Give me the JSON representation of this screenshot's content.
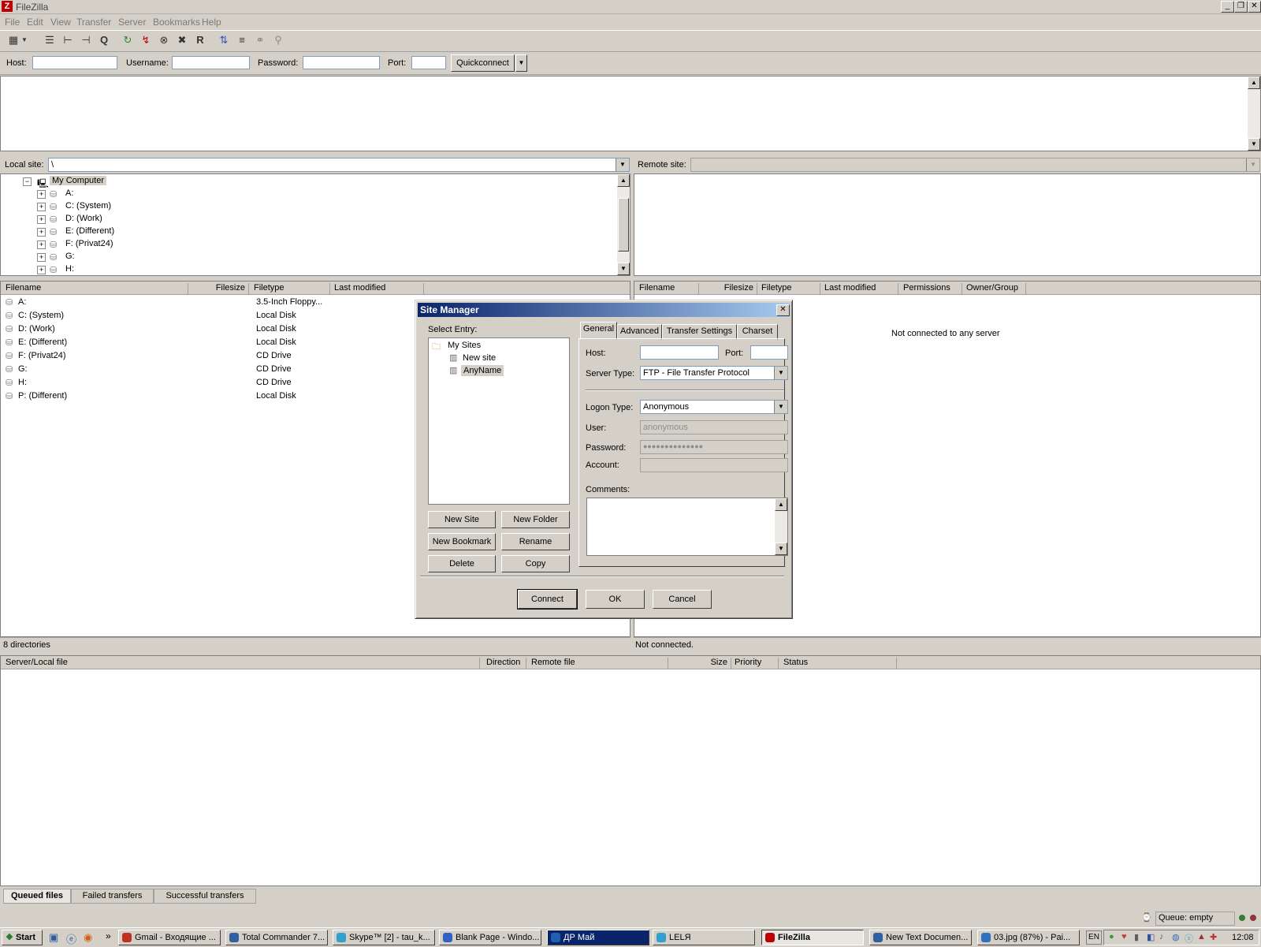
{
  "window": {
    "title": "FileZilla"
  },
  "menu": [
    "File",
    "Edit",
    "View",
    "Transfer",
    "Server",
    "Bookmarks",
    "Help"
  ],
  "quickconnect": {
    "host_label": "Host:",
    "username_label": "Username:",
    "password_label": "Password:",
    "port_label": "Port:",
    "button": "Quickconnect"
  },
  "local": {
    "label": "Local site:",
    "path": "\\",
    "tree": {
      "root": "My Computer",
      "items": [
        "A:",
        "C: (System)",
        "D: (Work)",
        "E: (Different)",
        "F: (Privat24)",
        "G:",
        "H:"
      ]
    },
    "columns": [
      "Filename",
      "Filesize",
      "Filetype",
      "Last modified"
    ],
    "files": [
      {
        "name": "A:",
        "type": "3.5-Inch Floppy..."
      },
      {
        "name": "C: (System)",
        "type": "Local Disk"
      },
      {
        "name": "D: (Work)",
        "type": "Local Disk"
      },
      {
        "name": "E: (Different)",
        "type": "Local Disk"
      },
      {
        "name": "F: (Privat24)",
        "type": "CD Drive"
      },
      {
        "name": "G:",
        "type": "CD Drive"
      },
      {
        "name": "H:",
        "type": "CD Drive"
      },
      {
        "name": "P: (Different)",
        "type": "Local Disk"
      }
    ],
    "status": "8 directories"
  },
  "remote": {
    "label": "Remote site:",
    "columns": [
      "Filename",
      "Filesize",
      "Filetype",
      "Last modified",
      "Permissions",
      "Owner/Group"
    ],
    "empty_msg": "Not connected to any server",
    "status": "Not connected."
  },
  "queue": {
    "columns": [
      "Server/Local file",
      "Direction",
      "Remote file",
      "Size",
      "Priority",
      "Status"
    ],
    "tabs": [
      "Queued files",
      "Failed transfers",
      "Successful transfers"
    ],
    "status": "Queue: empty"
  },
  "dialog": {
    "title": "Site Manager",
    "select_entry": "Select Entry:",
    "tree": {
      "root": "My Sites",
      "items": [
        "New site",
        "AnyName"
      ]
    },
    "tabs": [
      "General",
      "Advanced",
      "Transfer Settings",
      "Charset"
    ],
    "host_label": "Host:",
    "port_label": "Port:",
    "server_type_label": "Server Type:",
    "server_type": "FTP - File Transfer Protocol",
    "logon_type_label": "Logon Type:",
    "logon_type": "Anonymous",
    "user_label": "User:",
    "user_value": "anonymous",
    "password_label": "Password:",
    "password_value": "●●●●●●●●●●●●●●",
    "account_label": "Account:",
    "comments_label": "Comments:",
    "buttons": {
      "new_site": "New Site",
      "new_folder": "New Folder",
      "new_bookmark": "New Bookmark",
      "rename": "Rename",
      "delete": "Delete",
      "copy": "Copy",
      "connect": "Connect",
      "ok": "OK",
      "cancel": "Cancel"
    }
  },
  "taskbar": {
    "start": "Start",
    "tasks": [
      "Gmail - Входящие ...",
      "Total Commander 7...",
      "Skype™ [2] - tau_k...",
      "Blank Page - Windo...",
      "ДР Май",
      "LELЯ",
      "FileZilla",
      "New Text Documen...",
      "03.jpg (87%) - Pai..."
    ],
    "lang": "EN",
    "clock": "12:08"
  }
}
